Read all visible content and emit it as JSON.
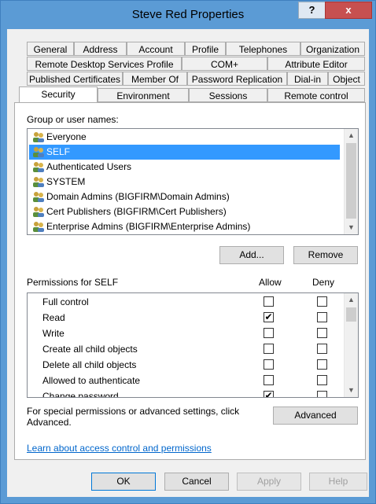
{
  "window": {
    "title": "Steve Red Properties",
    "help_label": "?",
    "close_label": "x"
  },
  "tabs": {
    "row1": [
      "General",
      "Address",
      "Account",
      "Profile",
      "Telephones",
      "Organization"
    ],
    "row2": [
      "Remote Desktop Services Profile",
      "COM+",
      "Attribute Editor"
    ],
    "row3": [
      "Published Certificates",
      "Member Of",
      "Password Replication",
      "Dial-in",
      "Object"
    ],
    "row4": [
      "Security",
      "Environment",
      "Sessions",
      "Remote control"
    ],
    "active": "Security"
  },
  "groups": {
    "label": "Group or user names:",
    "items": [
      "Everyone",
      "SELF",
      "Authenticated Users",
      "SYSTEM",
      "Domain Admins (BIGFIRM\\Domain Admins)",
      "Cert Publishers (BIGFIRM\\Cert Publishers)",
      "Enterprise Admins (BIGFIRM\\Enterprise Admins)"
    ],
    "selected": "SELF",
    "add_label": "Add...",
    "remove_label": "Remove"
  },
  "permissions": {
    "label": "Permissions for SELF",
    "allow_header": "Allow",
    "deny_header": "Deny",
    "rows": [
      {
        "name": "Full control",
        "allow": false,
        "deny": false
      },
      {
        "name": "Read",
        "allow": true,
        "deny": false
      },
      {
        "name": "Write",
        "allow": false,
        "deny": false
      },
      {
        "name": "Create all child objects",
        "allow": false,
        "deny": false
      },
      {
        "name": "Delete all child objects",
        "allow": false,
        "deny": false
      },
      {
        "name": "Allowed to authenticate",
        "allow": false,
        "deny": false
      },
      {
        "name": "Change password",
        "allow": true,
        "deny": false
      }
    ]
  },
  "advanced": {
    "text": "For special permissions or advanced settings, click Advanced.",
    "button_label": "Advanced"
  },
  "learn_link": "Learn about access control and permissions",
  "footer": {
    "ok": "OK",
    "cancel": "Cancel",
    "apply": "Apply",
    "help": "Help"
  },
  "colors": {
    "titlebar": "#5b9bd5",
    "selection": "#3399ff",
    "close": "#c75050",
    "link": "#0066cc"
  }
}
